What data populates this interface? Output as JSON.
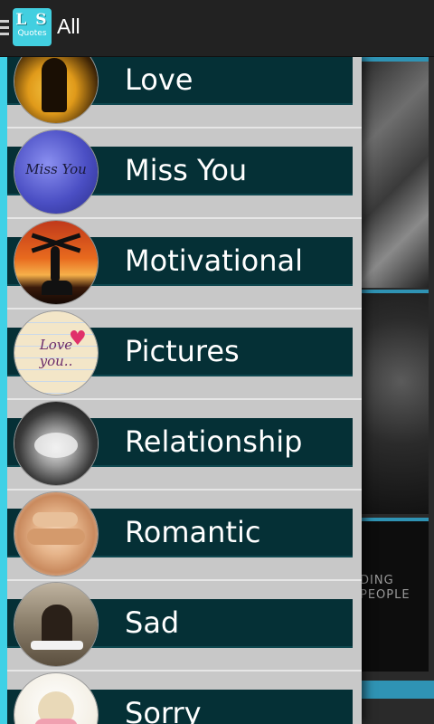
{
  "header": {
    "logo_top": "L S",
    "logo_bottom": "Quotes",
    "title": "All"
  },
  "background": {
    "card_text": "DING\nPEOPLE"
  },
  "drawer": {
    "items": [
      {
        "label": "Love"
      },
      {
        "label": "Miss You",
        "thumb_text": "Miss You"
      },
      {
        "label": "Motivational"
      },
      {
        "label": "Pictures",
        "thumb_text": "Love you.."
      },
      {
        "label": "Relationship"
      },
      {
        "label": "Romantic"
      },
      {
        "label": "Sad"
      },
      {
        "label": "Sorry"
      }
    ]
  },
  "colors": {
    "accent": "#3fd1e6",
    "band": "#053036",
    "drawer_bg": "#c8c8c8",
    "actionbar": "#222222"
  },
  "icons": [
    "menu-icon",
    "app-logo-icon"
  ]
}
